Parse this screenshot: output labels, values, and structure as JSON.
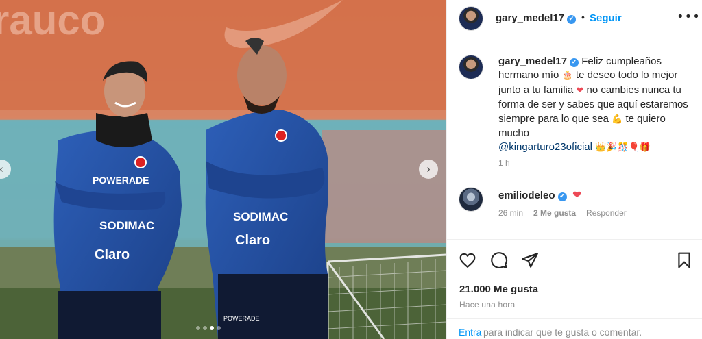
{
  "post": {
    "author": {
      "username": "gary_medel17",
      "verified_icon": "✔",
      "follow_label": "Seguir",
      "separator": "•",
      "more_icon": "•••"
    },
    "image": {
      "banner_text": "rauco",
      "jersey_text_left": "POWERADE",
      "sponsor_left": "SODIMAC",
      "sponsor_left2": "Claro",
      "sponsor_right": "SODIMAC",
      "sponsor_right2": "Claro",
      "shorts_text": "POWERADE",
      "prev_icon": "‹",
      "next_icon": "›",
      "dot_count": 4,
      "active_dot": 2
    },
    "caption": {
      "username": "gary_medel17",
      "text_1": " Feliz cumpleaños hermano mío ",
      "emoji_cake": "🎂",
      "text_2": " te deseo todo lo mejor junto a tu familia ",
      "emoji_heart": "❤",
      "text_3": " no cambies nunca tu forma de ser y sabes que aquí estaremos siempre para lo que sea ",
      "emoji_muscle": "💪",
      "text_4": " te quiero mucho ",
      "mention": "@kingarturo23oficial",
      "emoji_tail": "👑🎉🎊🎈🎁",
      "time": "1 h"
    },
    "reply": {
      "username": "emiliodeleo",
      "heart": "❤",
      "time": "26 min",
      "likes": "2 Me gusta",
      "reply_label": "Responder"
    },
    "actions": {
      "likes_count": "21.000 Me gusta",
      "posted": "Hace una hora",
      "login_link": "Entra",
      "login_text": "para indicar que te gusta o comentar."
    },
    "colors": {
      "link_blue": "#0095f6",
      "verified_blue": "#3897f0",
      "heart_red": "#ed4956",
      "muted": "#8e8e8e"
    }
  }
}
